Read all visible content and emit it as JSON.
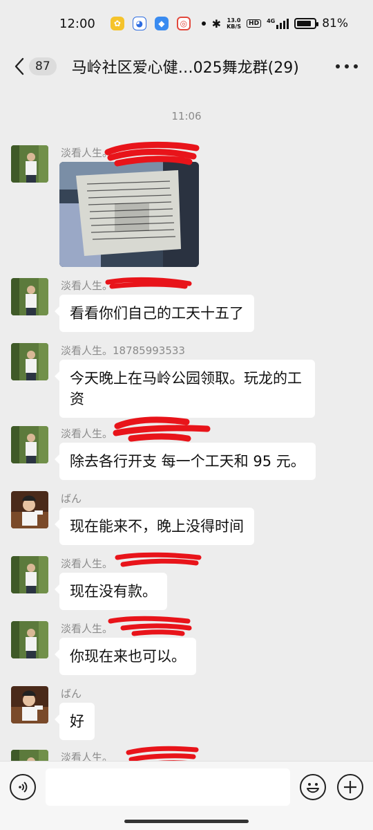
{
  "status_bar": {
    "time": "12:00",
    "net_speed_value": "13.0",
    "net_speed_unit": "KB/S",
    "hd_badge": "HD",
    "signal_label": "4G",
    "battery_text": "81%",
    "battery_level": 0.81
  },
  "header": {
    "unread_count": "87",
    "title": "马岭社区爱心健…025舞龙群(29)"
  },
  "messages": {
    "timestamp": "11:06",
    "items": [
      {
        "sender": "淡看人生。",
        "type": "image"
      },
      {
        "sender": "淡看人生。",
        "text": "看看你们自己的工天十五了"
      },
      {
        "sender": "淡看人生。18785993533",
        "text": "今天晚上在马岭公园领取。玩龙的工资"
      },
      {
        "sender": "淡看人生。",
        "text": "除去各行开支 每一个工天和 95 元。"
      },
      {
        "sender": "ばん",
        "text": "现在能来不，晚上没得时间"
      },
      {
        "sender": "淡看人生。",
        "text": "现在没有款。"
      },
      {
        "sender": "淡看人生。",
        "text": "你现在来也可以。"
      },
      {
        "sender": "ばん",
        "text": "好"
      },
      {
        "sender": "淡看人生。",
        "type": "partial"
      }
    ]
  },
  "colors": {
    "chat_bg": "#ededed",
    "bubble": "#ffffff",
    "redaction": "#e8141a"
  },
  "icons": {
    "back": "chevron-left-icon",
    "more": "more-dots-icon",
    "voice": "voice-icon",
    "emoji": "emoji-icon",
    "plus": "plus-icon"
  }
}
